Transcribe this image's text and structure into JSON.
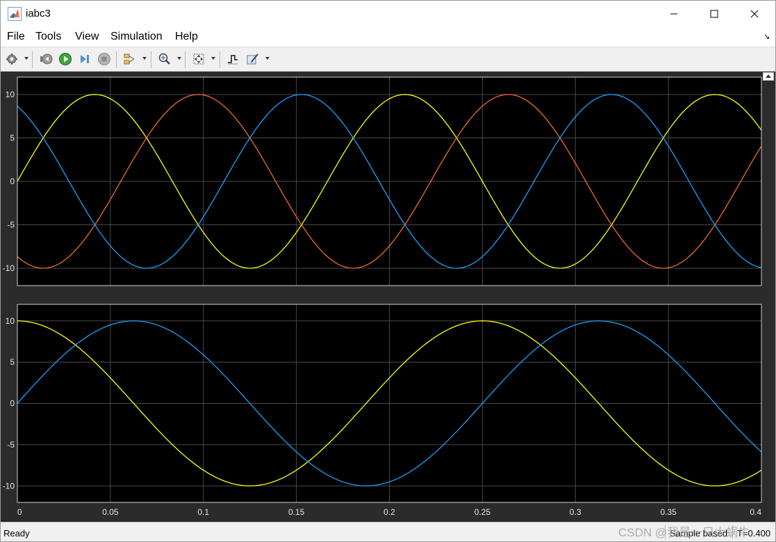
{
  "window": {
    "title": "iabc3",
    "controls": {
      "minimize": "minimize",
      "maximize": "maximize",
      "close": "close"
    }
  },
  "menu": {
    "items": [
      "File",
      "Tools",
      "View",
      "Simulation",
      "Help"
    ],
    "overflow_icon": "dock-arrow-icon"
  },
  "toolbar": {
    "icons": [
      "gear-icon",
      "step-back-icon",
      "run-icon",
      "step-forward-icon",
      "stop-icon",
      "signal-selector-icon",
      "zoom-icon",
      "fit-to-view-icon",
      "trigger-icon",
      "highlight-block-icon"
    ]
  },
  "colors": {
    "plot_bg": "#000000",
    "figure_bg": "#2b2b2b",
    "grid": "#4a4a4a",
    "axes_border": "#cfcfcf",
    "series_yellow": "#ffff10",
    "series_blue": "#19a2ff",
    "series_orange": "#f26a2e"
  },
  "chart_data": [
    {
      "type": "line",
      "xlim": [
        0,
        0.4
      ],
      "ylim": [
        -12,
        12
      ],
      "yticks": [
        10,
        5,
        0,
        -5,
        -10
      ],
      "ytick_labels": [
        "10",
        "5",
        "0",
        "-5",
        "-10"
      ],
      "xticks": [
        0,
        0.05,
        0.1,
        0.15,
        0.2,
        0.25,
        0.3,
        0.35,
        0.4
      ],
      "grid": true,
      "series": [
        {
          "color": "#ffff10",
          "amplitude": 10,
          "frequency_hz": 6,
          "phase_deg": 0
        },
        {
          "color": "#f26a2e",
          "amplitude": 10,
          "frequency_hz": 6,
          "phase_deg": -120
        },
        {
          "color": "#19a2ff",
          "amplitude": 10,
          "frequency_hz": 6,
          "phase_deg": 120
        }
      ]
    },
    {
      "type": "line",
      "xlim": [
        0,
        0.4
      ],
      "ylim": [
        -12,
        12
      ],
      "yticks": [
        10,
        5,
        0,
        -5,
        -10
      ],
      "ytick_labels": [
        "10",
        "5",
        "0",
        "-5",
        "-10"
      ],
      "xticks": [
        0,
        0.05,
        0.1,
        0.15,
        0.2,
        0.25,
        0.3,
        0.35,
        0.4
      ],
      "xtick_labels": [
        "0",
        "0.05",
        "0.1",
        "0.15",
        "0.2",
        "0.25",
        "0.3",
        "0.35",
        "0.4"
      ],
      "grid": true,
      "series": [
        {
          "color": "#ffff10",
          "amplitude": 10,
          "frequency_hz": 4,
          "phase_deg": 90
        },
        {
          "color": "#19a2ff",
          "amplitude": 10,
          "frequency_hz": 4,
          "phase_deg": 0
        }
      ]
    }
  ],
  "status": {
    "ready": "Ready",
    "sample_mode": "Sample based",
    "time": "T=0.400"
  },
  "watermark": "CSDN @我是一只大蜗牛"
}
